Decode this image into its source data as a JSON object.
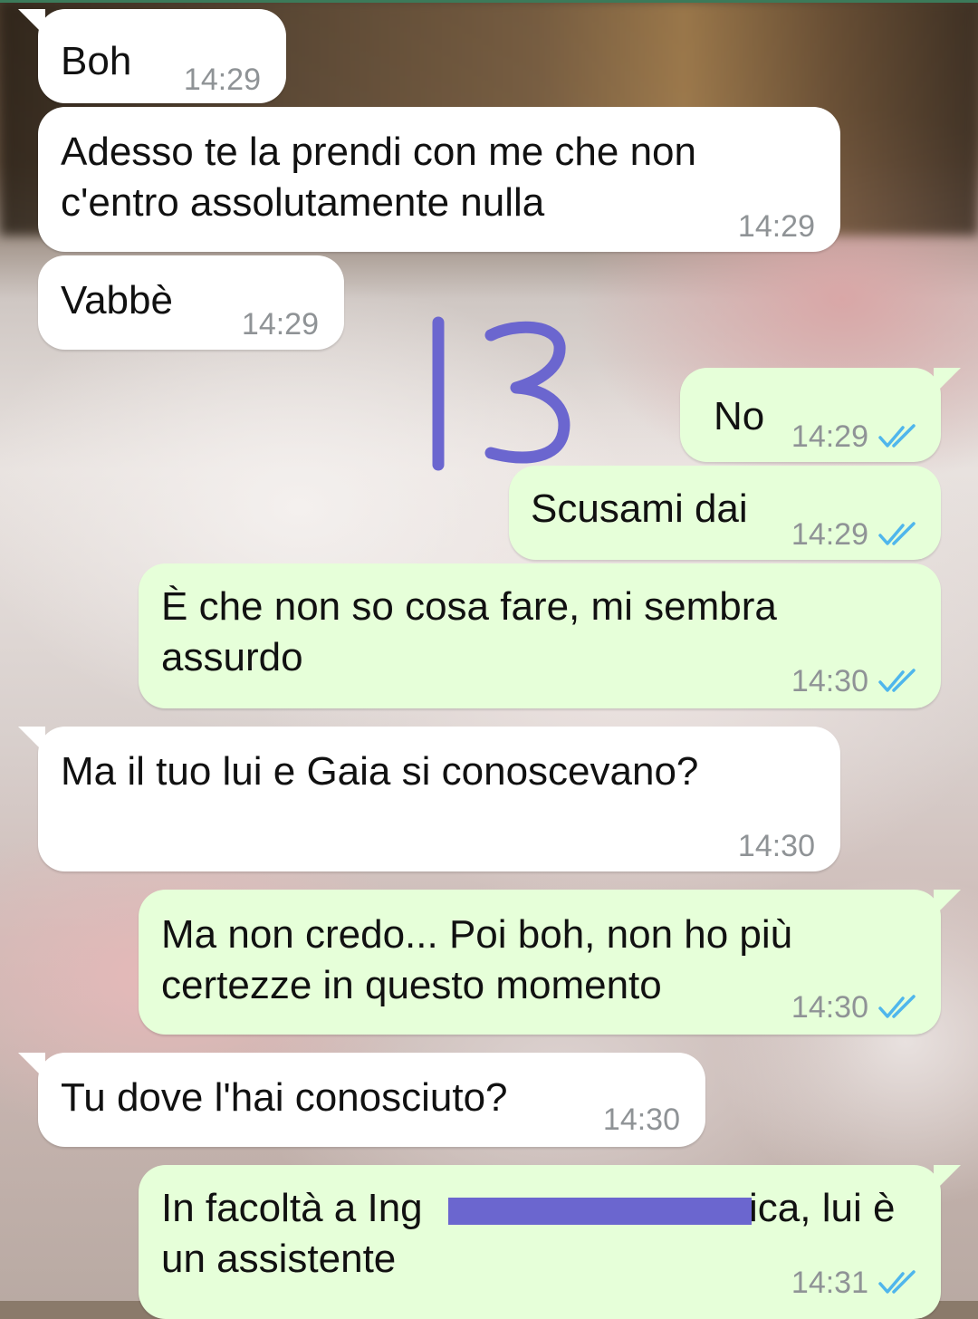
{
  "accent": {
    "incoming_bubble": "#ffffff",
    "outgoing_bubble": "#e6ffd9",
    "timestamp": "#8f9396",
    "read_ticks": "#4fb6ec",
    "annotation": "#6b66cf"
  },
  "annotation_label": "13",
  "messages": [
    {
      "direction": "incoming",
      "text": "Boh",
      "time": "14:29"
    },
    {
      "direction": "incoming",
      "text_lines": [
        "Adesso te la prendi con me che non",
        "c'entro assolutamente nulla"
      ],
      "time": "14:29"
    },
    {
      "direction": "incoming",
      "text": "Vabbè",
      "time": "14:29"
    },
    {
      "direction": "outgoing",
      "text": "No",
      "time": "14:29",
      "status_icon": "double-check-read"
    },
    {
      "direction": "outgoing",
      "text": "Scusami dai",
      "time": "14:29",
      "status_icon": "double-check-read"
    },
    {
      "direction": "outgoing",
      "text_lines": [
        "È che non so cosa fare, mi sembra",
        "assurdo"
      ],
      "time": "14:30",
      "status_icon": "double-check-read"
    },
    {
      "direction": "incoming",
      "text": "Ma il tuo lui e Gaia si conoscevano?",
      "time": "14:30"
    },
    {
      "direction": "outgoing",
      "text_lines": [
        "Ma non credo... Poi boh, non ho più",
        "certezze in questo momento"
      ],
      "time": "14:30",
      "status_icon": "double-check-read"
    },
    {
      "direction": "incoming",
      "text": "Tu dove l'hai conosciuto?",
      "time": "14:30"
    },
    {
      "direction": "outgoing",
      "text_lines": [
        "In facoltà a Ing",
        "ica, lui è",
        "un assistente"
      ],
      "time": "14:31",
      "status_icon": "double-check-read",
      "redacted": true
    }
  ]
}
